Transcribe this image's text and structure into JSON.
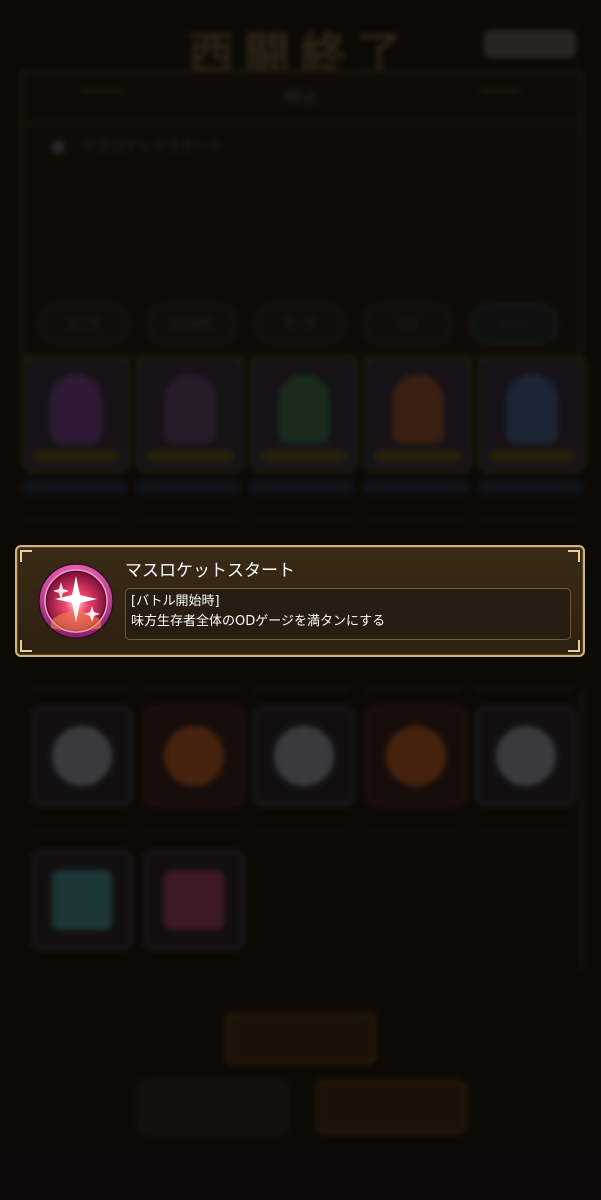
{
  "screen": {
    "title": "西闘終了",
    "badge": ""
  },
  "background_panel": {
    "header": "絞込",
    "entry_label": "マスロケットスタート",
    "filters": [
      {
        "label": "並び替"
      },
      {
        "label": "絞込解除"
      },
      {
        "label": "昇・降"
      },
      {
        "label": "追加"
      },
      {
        "label": "ソート"
      }
    ]
  },
  "characters": [
    {
      "name": "character-1"
    },
    {
      "name": "character-2"
    },
    {
      "name": "character-3"
    },
    {
      "name": "character-4"
    },
    {
      "name": "character-5"
    }
  ],
  "items": [
    {
      "type": "silver-orb"
    },
    {
      "type": "orange-orb"
    },
    {
      "type": "silver-orb"
    },
    {
      "type": "orange-orb"
    },
    {
      "type": "silver-orb"
    },
    {
      "type": "teal-crystal"
    },
    {
      "type": "pink-crystal"
    }
  ],
  "bottom_buttons": {
    "center": "",
    "left": "",
    "right": ""
  },
  "skill_popup": {
    "name": "マスロケットスタート",
    "trigger": "[バトル開始時]",
    "effect": "味方生存者全体のODゲージを満タンにする",
    "icon": "sparkle-burst-icon"
  },
  "colors": {
    "popup_border": "#cdb37d",
    "popup_bg": "#2e2111",
    "icon_ring": "#b0306e",
    "icon_core": "#e8375f"
  }
}
